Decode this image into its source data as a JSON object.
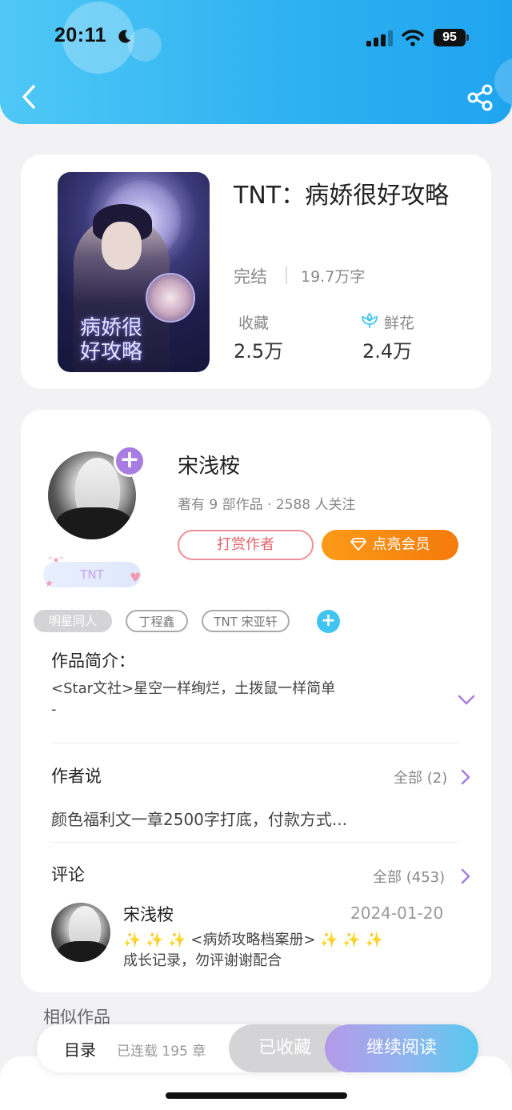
{
  "status_bar": {
    "time": "20:11",
    "battery": "95"
  },
  "book": {
    "title": "TNT：病娇很好攻略",
    "status": "完结",
    "word_count": "19.7万字",
    "cover_title": "病娇很\n好攻略",
    "stats": [
      {
        "label": "收藏",
        "value": "2.5万"
      },
      {
        "label": "鲜花",
        "value": "2.4万"
      }
    ]
  },
  "author": {
    "name": "宋浅桉",
    "meta": "著有 9 部作品 · 2588 人关注",
    "tip_label": "打赏作者",
    "vip_label": "点亮会员",
    "badge": "TNT"
  },
  "tags": [
    "明星同人",
    "丁程鑫",
    "TNT 宋亚轩"
  ],
  "intro": {
    "title": "作品简介：",
    "text_line1": "<Star文社>星空一样绚烂，土拨鼠一样简单",
    "text_line2": "-"
  },
  "author_says": {
    "title": "作者说",
    "see_all": "全部 (2)",
    "text": "颜色福利文一章2500字打底，付款方式..."
  },
  "comments": {
    "title": "评论",
    "see_all": "全部 (453)",
    "items": [
      {
        "name": "宋浅桉",
        "date": "2024-01-20",
        "line1": "✨ ✨ ✨ <病娇攻略档案册> ✨ ✨ ✨",
        "line2": "成长记录，勿评谢谢配合"
      }
    ]
  },
  "similar": {
    "title": "相似作品"
  },
  "bottom_bar": {
    "toc": "目录",
    "serial": "已连载 195 章",
    "collected": "已收藏",
    "continue": "继续阅读"
  },
  "colors": {
    "header_start": "#4fc8f5",
    "header_end": "#1fa4ef",
    "vip_orange": "#f57a0b",
    "tip_red": "#e0646c",
    "accent_purple": "#a77ce3"
  }
}
